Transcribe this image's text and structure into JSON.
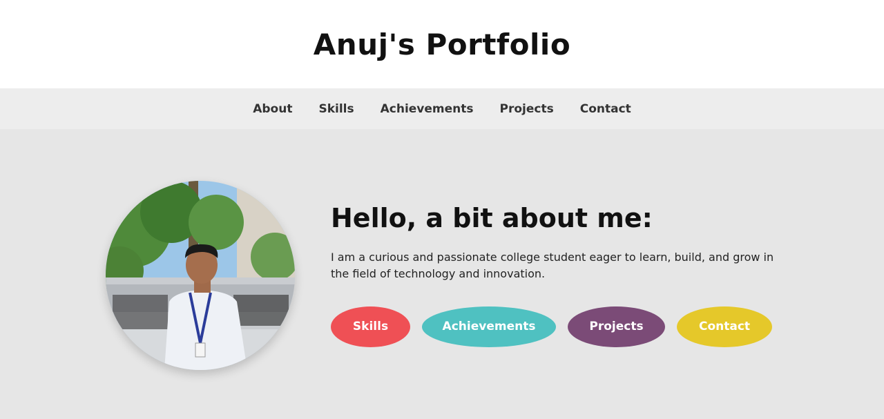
{
  "header": {
    "title": "Anuj's Portfolio"
  },
  "nav": {
    "items": [
      {
        "label": "About"
      },
      {
        "label": "Skills"
      },
      {
        "label": "Achievements"
      },
      {
        "label": "Projects"
      },
      {
        "label": "Contact"
      }
    ]
  },
  "about": {
    "heading": "Hello, a bit about me:",
    "text": "I am a curious and passionate college student eager to learn, build, and grow in the field of technology and innovation."
  },
  "buttons": [
    {
      "label": "Skills",
      "color": "#ef5055"
    },
    {
      "label": "Achievements",
      "color": "#4fc1c1"
    },
    {
      "label": "Projects",
      "color": "#7b4b77"
    },
    {
      "label": "Contact",
      "color": "#e5c82a"
    }
  ],
  "colors": {
    "header_bg": "#ffffff",
    "nav_bg": "#ededed",
    "page_bg": "#e6e6e6"
  }
}
